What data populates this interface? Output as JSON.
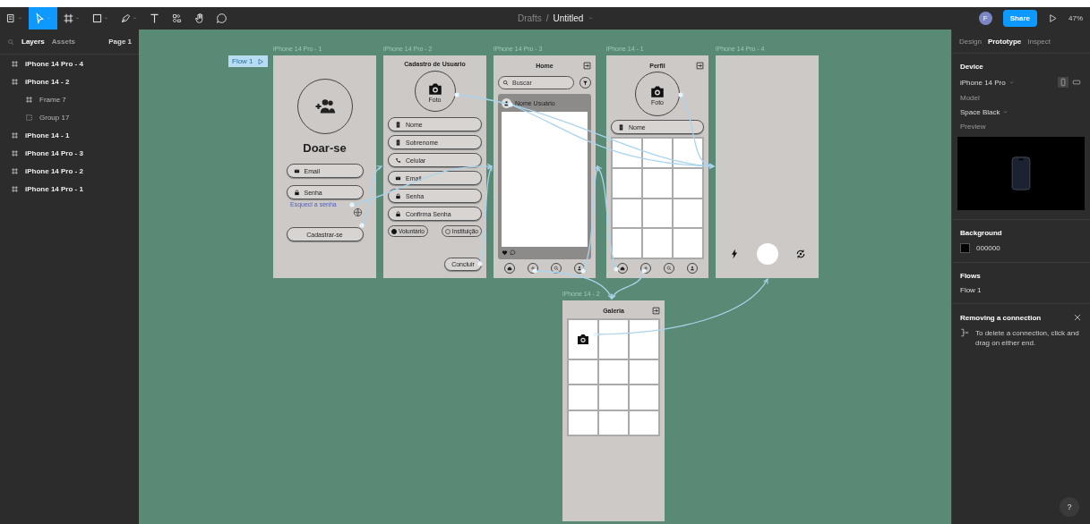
{
  "toolbar": {
    "tools": [
      {
        "kind": "menu",
        "selected": false
      },
      {
        "kind": "move",
        "selected": true
      },
      {
        "kind": "frame",
        "selected": false
      },
      {
        "kind": "shape",
        "selected": false
      },
      {
        "kind": "pen",
        "selected": false
      },
      {
        "kind": "text",
        "selected": false
      },
      {
        "kind": "resources",
        "selected": false
      },
      {
        "kind": "hand",
        "selected": false
      },
      {
        "kind": "comment",
        "selected": false
      }
    ],
    "folder": "Drafts",
    "separator": "/",
    "file": "Untitled",
    "avatar": "F",
    "share": "Share",
    "zoom": "47%"
  },
  "left_panel": {
    "tabs": [
      {
        "label": "Layers",
        "selected": true
      },
      {
        "label": "Assets",
        "selected": false
      }
    ],
    "page": "Page 1",
    "layers": [
      {
        "name": "iPhone 14 Pro - 4",
        "kind": "frame"
      },
      {
        "name": "iPhone 14 - 2",
        "kind": "frame",
        "children": [
          {
            "name": "Frame 7",
            "kind": "frame"
          },
          {
            "name": "Group 17",
            "kind": "group"
          }
        ]
      },
      {
        "name": "iPhone 14 - 1",
        "kind": "frame"
      },
      {
        "name": "iPhone 14 Pro - 3",
        "kind": "frame"
      },
      {
        "name": "iPhone 14 Pro - 2",
        "kind": "frame"
      },
      {
        "name": "iPhone 14 Pro - 1",
        "kind": "frame"
      }
    ]
  },
  "canvas": {
    "flow": "Flow 1",
    "frames": [
      {
        "kind": "login",
        "label": "iPhone 14 Pro - 1",
        "title": "Doar-se",
        "fields": [
          "Email",
          "Senha"
        ],
        "link": "Esqueci a senha",
        "button": "Cadastrar-se"
      },
      {
        "kind": "signup",
        "label": "iPhone 14 Pro - 2",
        "title": "Cadastro de Usuario",
        "photo": "Foto",
        "fields": [
          "Nome",
          "Sobrenome",
          "Celular",
          "Email",
          "Senha",
          "Confirma Senha"
        ],
        "options": [
          {
            "label": "Voluntário",
            "selected": true
          },
          {
            "label": "Instituição",
            "selected": false
          }
        ],
        "button": "Concluir"
      },
      {
        "kind": "feed",
        "label": "iPhone 14 Pro - 3",
        "title": "Home",
        "search": {
          "placeholder": "Buscar"
        },
        "post": {
          "user": "Nome Usuário"
        }
      },
      {
        "kind": "profile",
        "label": "iPhone 14 - 1",
        "title": "Perfil",
        "photo": "Foto",
        "fields": [
          "Nome"
        ]
      },
      {
        "kind": "camera",
        "label": "iPhone 14 Pro - 4"
      },
      {
        "kind": "gallery",
        "label": "iPhone 14 - 2",
        "title": "Galeria"
      }
    ]
  },
  "right_panel": {
    "tabs": [
      {
        "label": "Design",
        "selected": false
      },
      {
        "label": "Prototype",
        "selected": true
      },
      {
        "label": "Inspect",
        "selected": false
      }
    ],
    "device": {
      "heading": "Device",
      "name": "iPhone 14 Pro",
      "orientations": [
        {
          "kind": "portrait",
          "selected": true
        },
        {
          "kind": "landscape",
          "selected": false
        }
      ],
      "model_label": "Model",
      "model": "Space Black",
      "preview_label": "Preview"
    },
    "background": {
      "heading": "Background",
      "value": "000000"
    },
    "flows": {
      "heading": "Flows",
      "items": [
        "Flow 1"
      ]
    },
    "tip": {
      "title": "Removing a connection",
      "text": "To delete a connection, click and drag on either end."
    },
    "help": "?"
  }
}
